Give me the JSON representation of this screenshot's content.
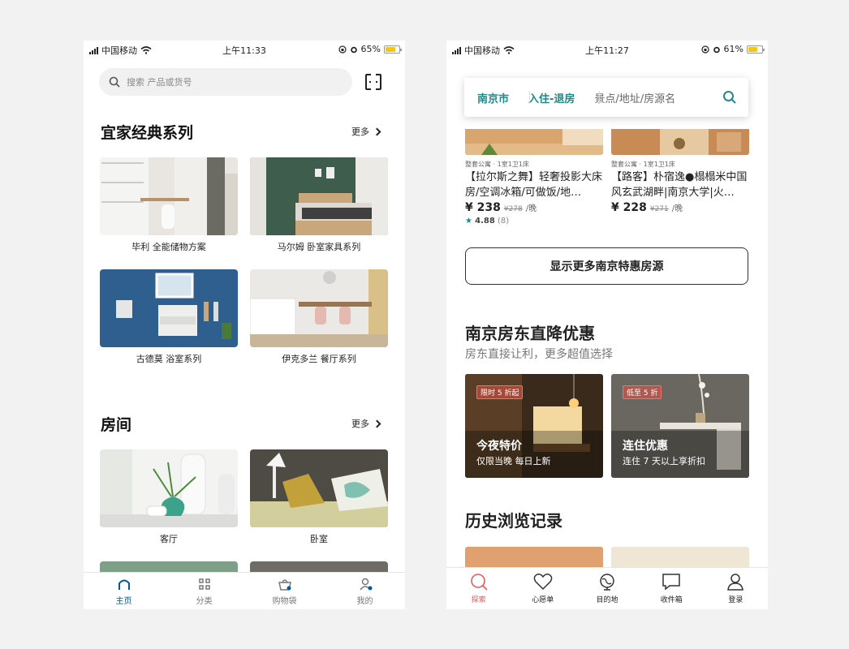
{
  "left": {
    "status": {
      "carrier": "中国移动",
      "time": "上午11:33",
      "battery": "65%"
    },
    "search": {
      "placeholder": "搜索 产品或货号"
    },
    "section1": {
      "title": "宜家经典系列",
      "more": "更多",
      "cards": [
        {
          "label": "毕利 全能储物方案"
        },
        {
          "label": "马尔姆 卧室家具系列"
        },
        {
          "label": "古德莫 浴室系列"
        },
        {
          "label": "伊克多兰 餐厅系列"
        }
      ]
    },
    "section2": {
      "title": "房间",
      "more": "更多",
      "cards": [
        {
          "label": "客厅"
        },
        {
          "label": "卧室"
        }
      ]
    },
    "tabs": [
      {
        "label": "主页",
        "icon": "home-icon"
      },
      {
        "label": "分类",
        "icon": "grid-icon"
      },
      {
        "label": "购物袋",
        "icon": "bag-icon"
      },
      {
        "label": "我的",
        "icon": "user-icon"
      }
    ],
    "accent": "#0058a3"
  },
  "right": {
    "status": {
      "carrier": "中国移动",
      "time": "上午11:27",
      "battery": "61%"
    },
    "search": {
      "city": "南京市",
      "dates": "入住-退房",
      "keyword": "景点/地址/房源名"
    },
    "listings": [
      {
        "meta": "整套公寓 · 1室1卫1床",
        "title": "【拉尔斯之舞】轻奢投影大床房/空调冰箱/可做饭/地…",
        "price": "¥ 238",
        "old_price": "¥278",
        "unit": "/晚",
        "rating": "4.88",
        "reviews": "(8)"
      },
      {
        "meta": "整套公寓 · 1室1卫1床",
        "title": "【路客】朴宿逸●榻榻米中国风玄武湖畔|南京大学|火…",
        "price": "¥ 228",
        "old_price": "¥271",
        "unit": "/晚"
      }
    ],
    "more_button": "显示更多南京特惠房源",
    "deals_section": {
      "title": "南京房东直降优惠",
      "subtitle": "房东直接让利，更多超值选择",
      "deals": [
        {
          "tag": "限时 5 折起",
          "title": "今夜特价",
          "subtitle": "仅限当晚 每日上新"
        },
        {
          "tag": "低至 5 折",
          "title": "连住优惠",
          "subtitle": "连住 7 天以上享折扣"
        }
      ]
    },
    "history": {
      "title": "历史浏览记录"
    },
    "tabs": [
      {
        "label": "探索",
        "icon": "search-icon"
      },
      {
        "label": "心愿单",
        "icon": "heart-icon"
      },
      {
        "label": "目的地",
        "icon": "globe-icon"
      },
      {
        "label": "收件箱",
        "icon": "chat-icon"
      },
      {
        "label": "登录",
        "icon": "user-icon"
      }
    ],
    "accent": "#1f8a8a"
  }
}
